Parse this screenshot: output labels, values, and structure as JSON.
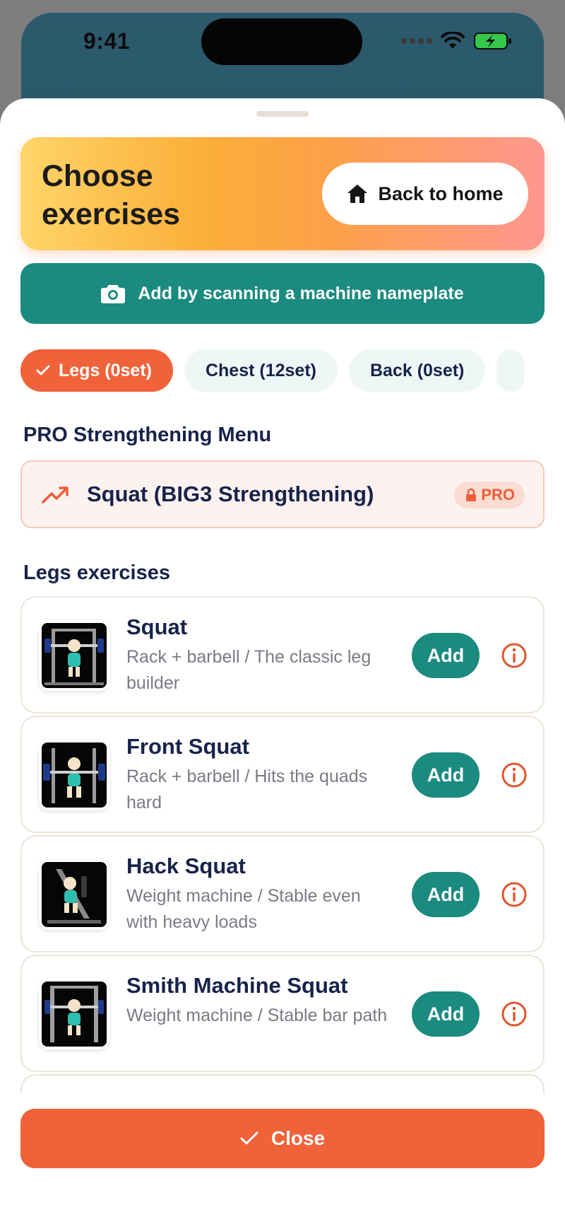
{
  "status_bar": {
    "time": "9:41"
  },
  "header": {
    "title": "Choose exercises",
    "home_button": "Back to home"
  },
  "scan_button": "Add by scanning a machine nameplate",
  "tabs": [
    {
      "label": "Legs (0set)",
      "selected": true
    },
    {
      "label": "Chest (12set)",
      "selected": false
    },
    {
      "label": "Back (0set)",
      "selected": false
    }
  ],
  "pro_section": {
    "title": "PRO Strengthening Menu",
    "item": "Squat (BIG3 Strengthening)",
    "badge": "PRO"
  },
  "exercise_section": {
    "title": "Legs exercises",
    "add_label": "Add",
    "items": [
      {
        "name": "Squat",
        "description": "Rack + barbell / The classic leg builder"
      },
      {
        "name": "Front Squat",
        "description": "Rack + barbell / Hits the quads hard"
      },
      {
        "name": "Hack Squat",
        "description": "Weight machine / Stable even with heavy loads"
      },
      {
        "name": "Smith Machine Squat",
        "description": "Weight machine / Stable bar path"
      }
    ]
  },
  "close_button": "Close",
  "colors": {
    "accent_orange": "#f06239",
    "teal": "#1b8a7f",
    "navy_text": "#17234a"
  }
}
